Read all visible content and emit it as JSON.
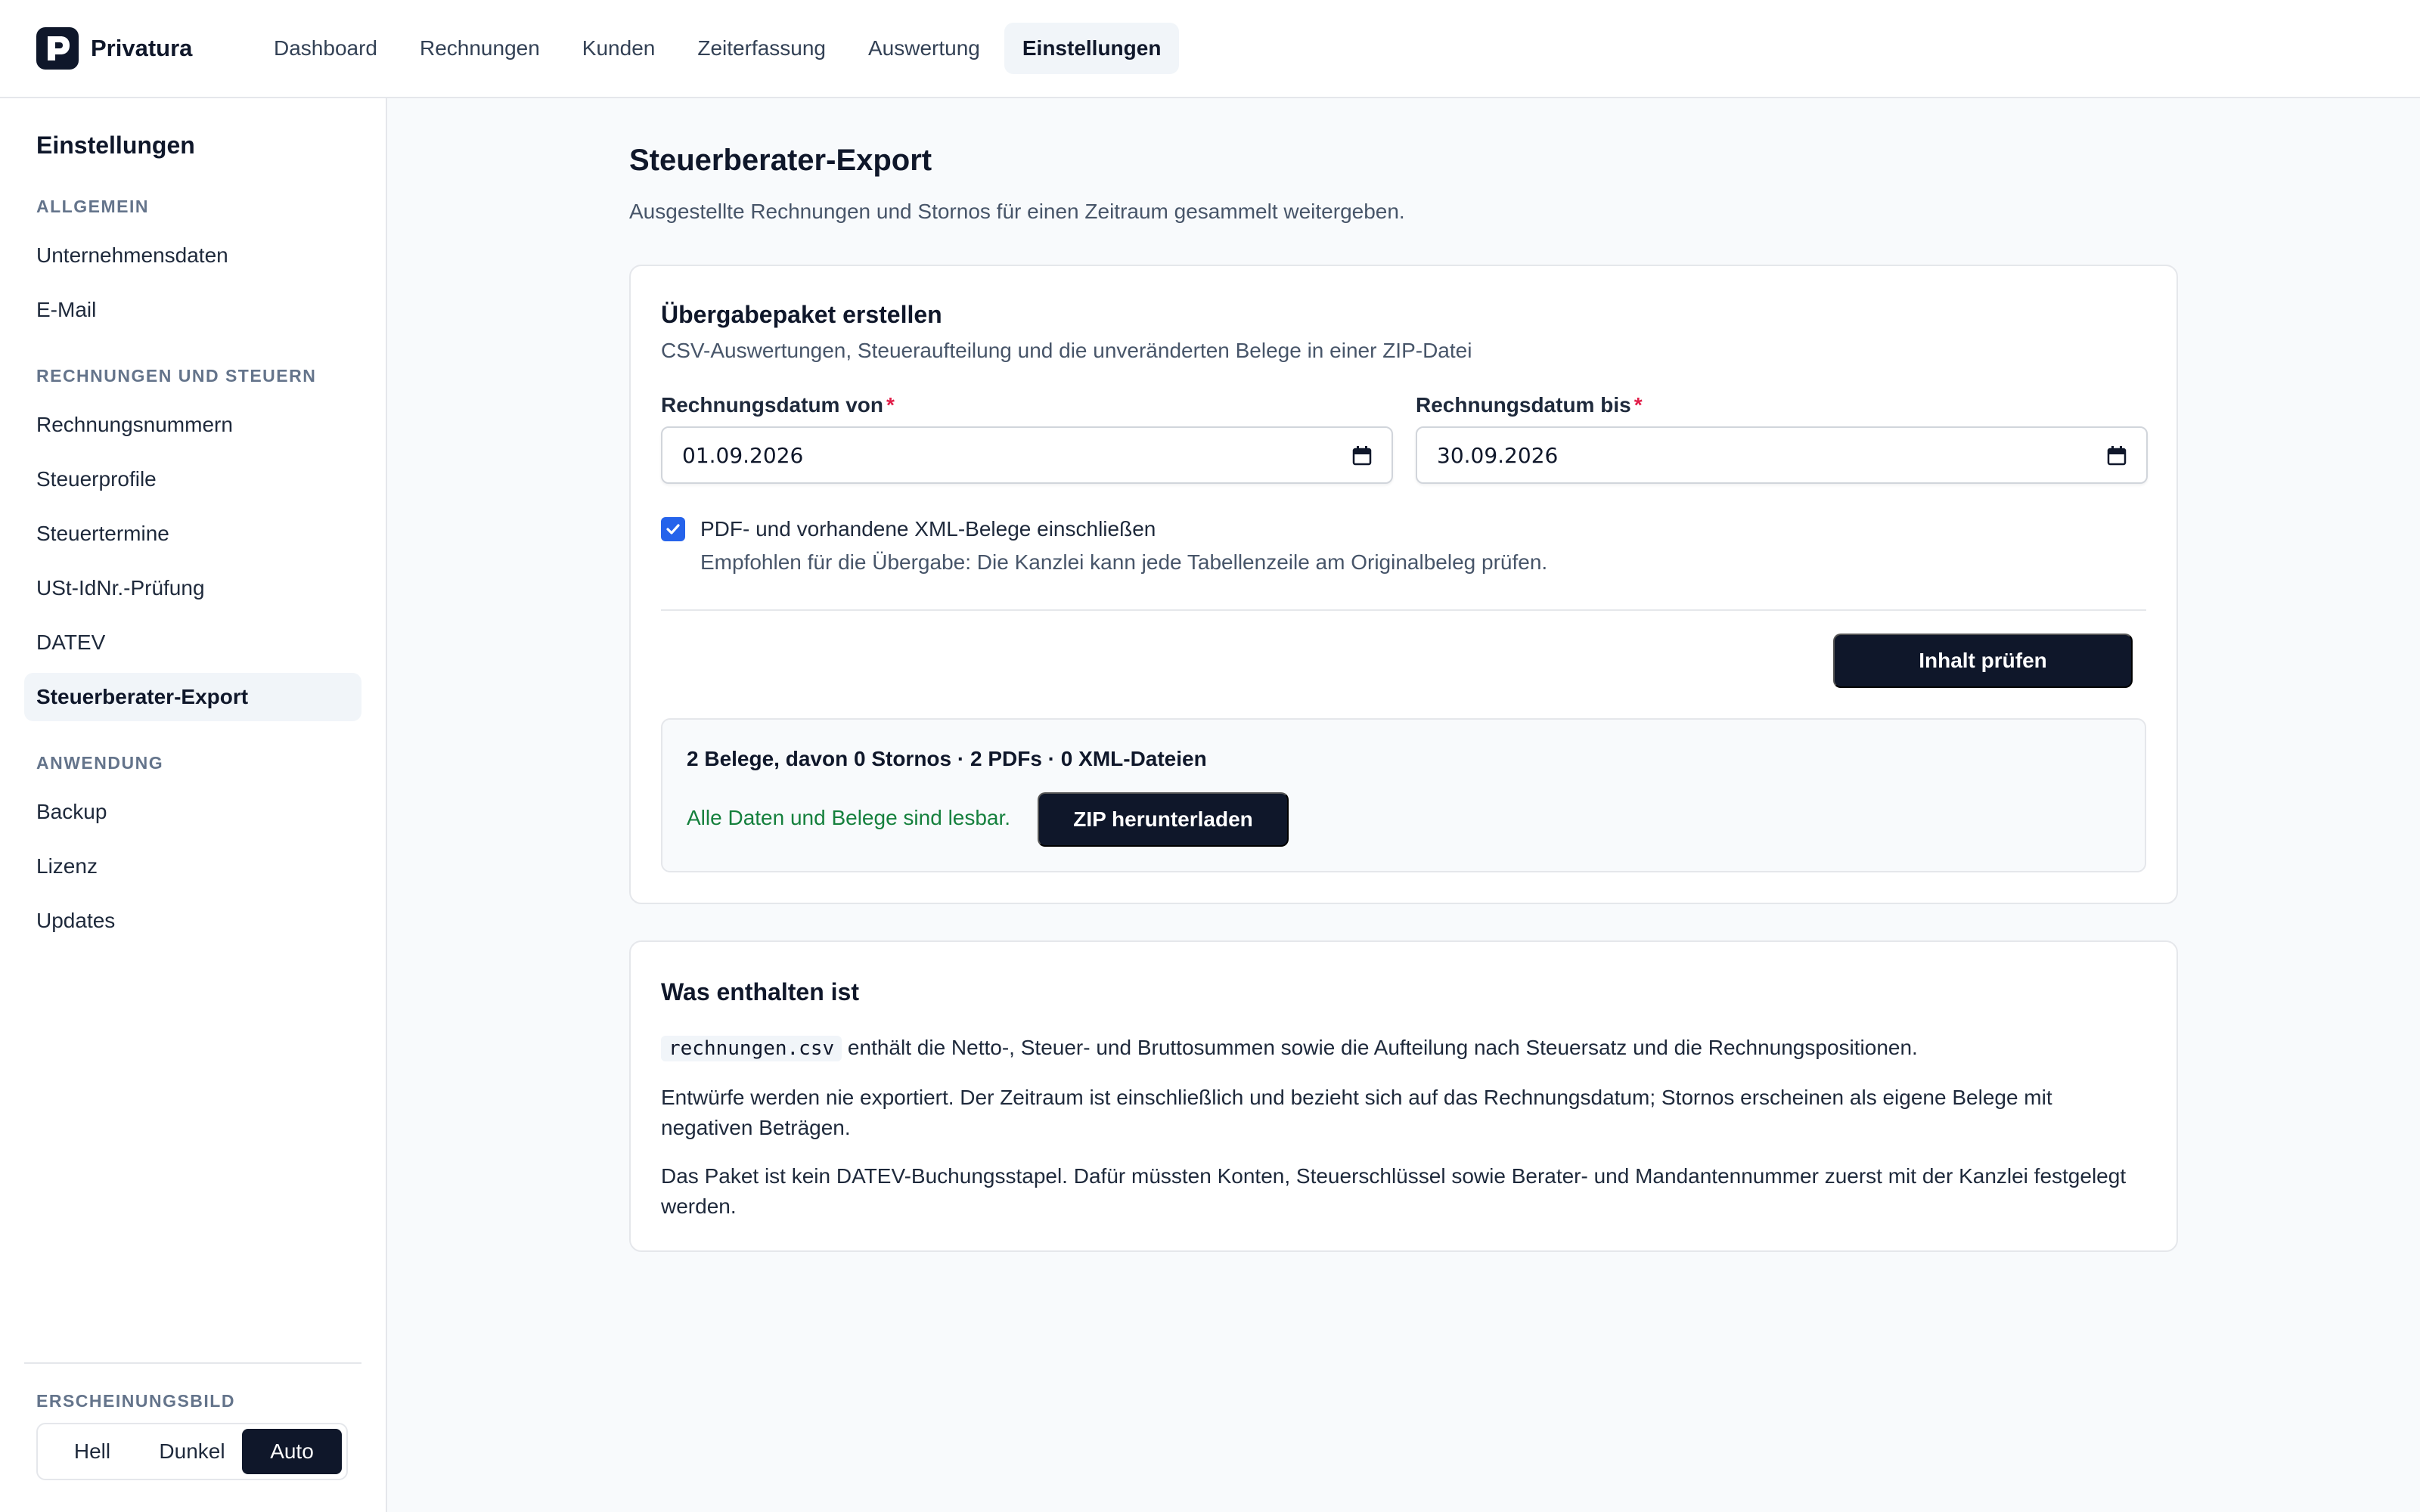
{
  "app": {
    "name": "Privatura",
    "logo_icon": "privatura-logo-icon"
  },
  "nav": {
    "items": [
      {
        "label": "Dashboard"
      },
      {
        "label": "Rechnungen"
      },
      {
        "label": "Kunden"
      },
      {
        "label": "Zeiterfassung"
      },
      {
        "label": "Auswertung"
      },
      {
        "label": "Einstellungen",
        "active": true
      }
    ]
  },
  "sidebar": {
    "title": "Einstellungen",
    "sections": [
      {
        "heading": "ALLGEMEIN",
        "items": [
          "Unternehmensdaten",
          "E-Mail"
        ]
      },
      {
        "heading": "RECHNUNGEN UND STEUERN",
        "items": [
          "Rechnungsnummern",
          "Steuerprofile",
          "Steuertermine",
          "USt-IdNr.-Prüfung",
          "DATEV",
          "Steuerberater-Export"
        ]
      },
      {
        "heading": "ANWENDUNG",
        "items": [
          "Backup",
          "Lizenz",
          "Updates"
        ]
      }
    ],
    "active_item": "Steuerberater-Export",
    "appearance": {
      "heading": "ERSCHEINUNGSBILD",
      "options": [
        "Hell",
        "Dunkel",
        "Auto"
      ],
      "selected": "Auto"
    }
  },
  "page": {
    "title": "Steuerberater-Export",
    "subtitle": "Ausgestellte Rechnungen und Stornos für einen Zeitraum gesammelt weitergeben."
  },
  "export_card": {
    "title": "Übergabepaket erstellen",
    "subtitle": "CSV-Auswertungen, Steueraufteilung und die unveränderten Belege in einer ZIP-Datei",
    "date_from": {
      "label": "Rechnungsdatum von",
      "required_mark": "*",
      "value": "01.09.2026"
    },
    "date_to": {
      "label": "Rechnungsdatum bis",
      "required_mark": "*",
      "value": "30.09.2026"
    },
    "include_receipts": {
      "checked": true,
      "label": "PDF- und vorhandene XML-Belege einschließen",
      "help": "Empfohlen für die Übergabe: Die Kanzlei kann jede Tabellenzeile am Originalbeleg prüfen."
    },
    "check_button": "Inhalt prüfen",
    "result": {
      "summary": "2 Belege, davon 0 Stornos · 2 PDFs · 0 XML-Dateien",
      "status": "Alle Daten und Belege sind lesbar.",
      "download_button": "ZIP herunterladen"
    }
  },
  "info_card": {
    "title": "Was enthalten ist",
    "code_file": "rechnungen.csv",
    "p1_rest": " enthält die Netto-, Steuer- und Bruttosummen sowie die Aufteilung nach Steuersatz und die Rechnungspositionen.",
    "p2": "Entwürfe werden nie exportiert. Der Zeitraum ist einschließlich und bezieht sich auf das Rechnungsdatum; Stornos erscheinen als eigene Belege mit negativen Beträgen.",
    "p3": "Das Paket ist kein DATEV-Buchungsstapel. Dafür müssten Konten, Steuerschlüssel sowie Berater- und Mandantennummer zuerst mit der Kanzlei festgelegt werden."
  },
  "colors": {
    "primary_dark": "#0f172a",
    "accent_blue": "#2563eb",
    "success_green": "#15803d",
    "required_red": "#e11d48"
  }
}
